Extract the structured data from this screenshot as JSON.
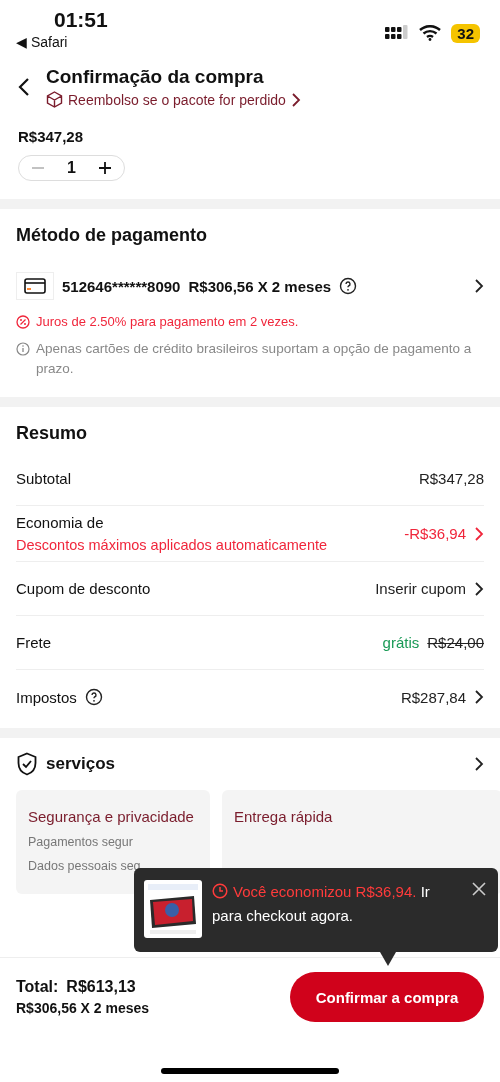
{
  "status_bar": {
    "time": "01:51",
    "back_app": "◀ Safari",
    "battery": "32"
  },
  "header": {
    "title": "Confirmação da compra",
    "subtitle": "Reembolso se o pacote for perdido"
  },
  "product": {
    "price": "R$347,28",
    "quantity": "1"
  },
  "payment": {
    "title": "Método de pagamento",
    "card": "512646******8090",
    "installment": "R$306,56 X 2 meses",
    "interest": "Juros de 2.50% para pagamento em 2 vezes.",
    "note": "Apenas cartões de crédito brasileiros suportam a opção de pagamento a prazo."
  },
  "summary": {
    "title": "Resumo",
    "rows": [
      {
        "kind": "plain",
        "label": "Subtotal",
        "value": "R$347,28",
        "chevron": false
      },
      {
        "kind": "discount",
        "label": "Economia de",
        "sublabel": "Descontos máximos aplicados automaticamente",
        "value": "-R$36,94",
        "chevron": true
      },
      {
        "kind": "plain",
        "label": "Cupom de desconto",
        "value": "Inserir cupom",
        "chevron": true
      },
      {
        "kind": "shipping",
        "label": "Frete",
        "value": "grátis",
        "original_price": "R$24,00",
        "chevron": false
      },
      {
        "kind": "help",
        "label": "Impostos",
        "value": "R$287,84",
        "chevron": true
      }
    ]
  },
  "services": {
    "title": "serviços",
    "cards": [
      {
        "title": "Segurança e privacidade",
        "lines": [
          "Pagamentos segur",
          "Dados pessoais seg"
        ]
      },
      {
        "title": "Entrega rápida"
      }
    ]
  },
  "toast": {
    "highlight": "Você economizou R$36,94.",
    "text": " Ir para checkout agora."
  },
  "footer": {
    "total_label": "Total:",
    "total": "R$613,13",
    "installment": "R$306,56 X 2 meses",
    "button": "Confirmar a compra"
  }
}
